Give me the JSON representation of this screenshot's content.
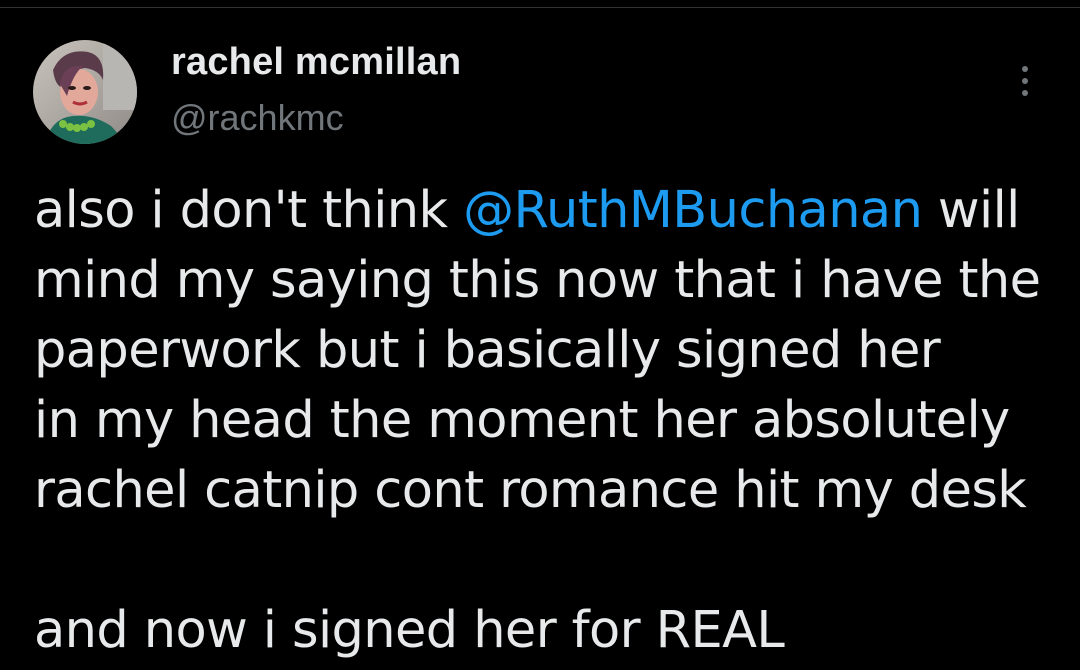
{
  "tweet": {
    "author_name": "rachel mcmillan",
    "author_handle": "@rachkmc",
    "body": {
      "line1_before": "also i don't think ",
      "mention": "@RuthMBuchanan",
      "line1_after": " will",
      "line2": "mind my saying this now that i have the",
      "line3": "paperwork but i basically signed her",
      "line4": "in my head the moment her absolutely",
      "line5": "rachel catnip cont romance hit my desk",
      "line7": "and now i signed her for REAL"
    },
    "more_icon": "more-vertical-icon"
  },
  "colors": {
    "background": "#000000",
    "text": "#e7e9ea",
    "secondary_text": "#71767b",
    "mention": "#1d9bf0"
  }
}
